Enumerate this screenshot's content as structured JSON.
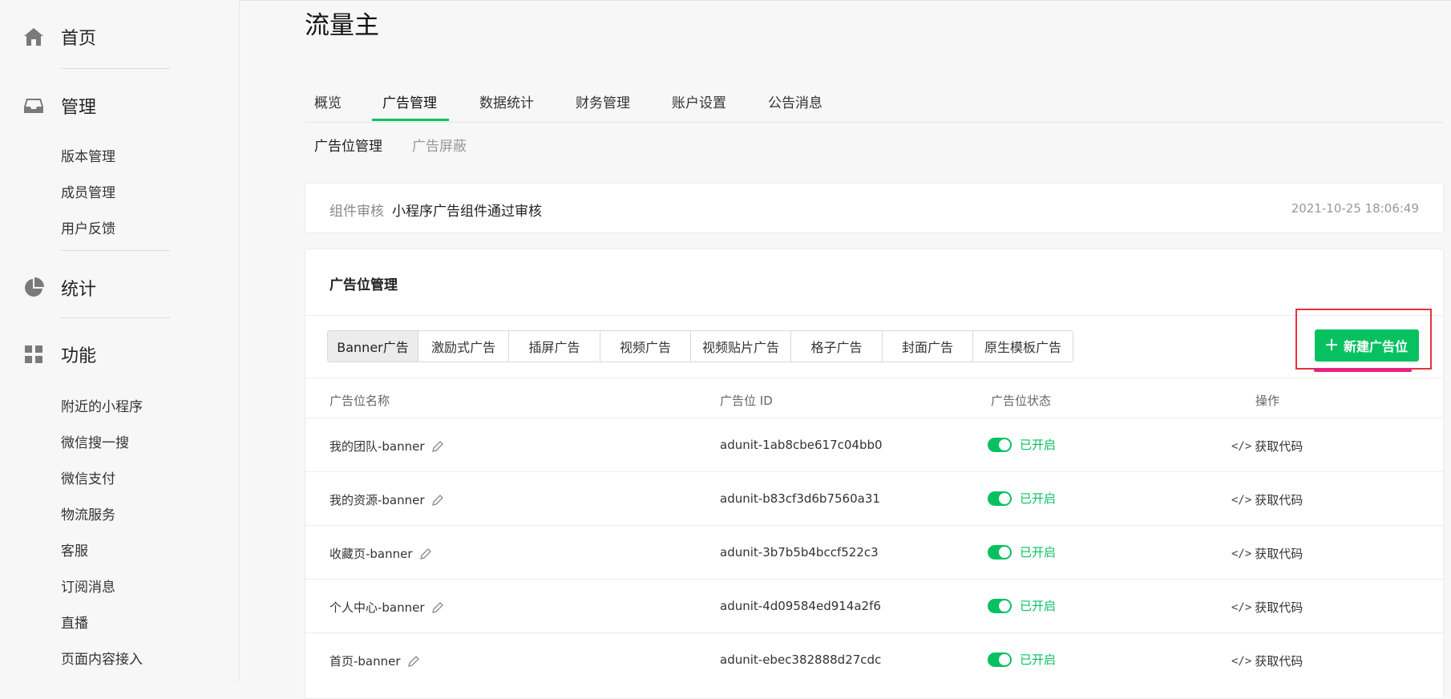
{
  "sidebar": {
    "home": {
      "label": "首页",
      "icon": "home-icon"
    },
    "manage": {
      "label": "管理",
      "icon": "inbox-icon",
      "items": [
        "版本管理",
        "成员管理",
        "用户反馈"
      ]
    },
    "stats": {
      "label": "统计",
      "icon": "pie-chart-icon"
    },
    "features": {
      "label": "功能",
      "icon": "grid-icon",
      "items": [
        "附近的小程序",
        "微信搜一搜",
        "微信支付",
        "物流服务",
        "客服",
        "订阅消息",
        "直播",
        "页面内容接入"
      ]
    }
  },
  "page": {
    "title": "流量主"
  },
  "tabs": [
    "概览",
    "广告管理",
    "数据统计",
    "财务管理",
    "账户设置",
    "公告消息"
  ],
  "active_tab": "广告管理",
  "subtabs": [
    "广告位管理",
    "广告屏蔽"
  ],
  "active_subtab": "广告位管理",
  "notice": {
    "label": "组件审核",
    "text": "小程序广告组件通过审核",
    "time": "2021-10-25 18:06:49"
  },
  "card": {
    "title": "广告位管理",
    "ad_types": [
      "Banner广告",
      "激励式广告",
      "插屏广告",
      "视频广告",
      "视频贴片广告",
      "格子广告",
      "封面广告",
      "原生模板广告"
    ],
    "active_ad_type": "Banner广告",
    "new_button": "新建广告位",
    "columns": [
      "广告位名称",
      "广告位 ID",
      "广告位状态",
      "操作"
    ],
    "rows": [
      {
        "name": "我的团队-banner",
        "id": "adunit-1ab8cbe617c04bb0",
        "status": "已开启",
        "action": "获取代码"
      },
      {
        "name": "我的资源-banner",
        "id": "adunit-b83cf3d6b7560a31",
        "status": "已开启",
        "action": "获取代码"
      },
      {
        "name": "收藏页-banner",
        "id": "adunit-3b7b5b4bccf522c3",
        "status": "已开启",
        "action": "获取代码"
      },
      {
        "name": "个人中心-banner",
        "id": "adunit-4d09584ed914a2f6",
        "status": "已开启",
        "action": "获取代码"
      },
      {
        "name": "首页-banner",
        "id": "adunit-ebec382888d27cdc",
        "status": "已开启",
        "action": "获取代码"
      }
    ]
  },
  "colors": {
    "accent": "#07c160",
    "highlight_box": "#e8323c",
    "highlight_underline": "#e91e8c"
  }
}
